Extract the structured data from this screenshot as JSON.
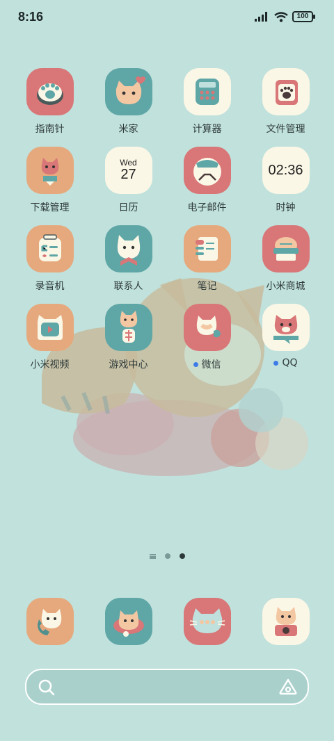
{
  "status_bar": {
    "time": "8:16",
    "battery": "100"
  },
  "apps": [
    {
      "label": "指南针",
      "icon": "paw-compass-icon",
      "badge": false
    },
    {
      "label": "米家",
      "icon": "cat-heart-icon",
      "badge": false
    },
    {
      "label": "计算器",
      "icon": "calculator-icon",
      "badge": false
    },
    {
      "label": "文件管理",
      "icon": "folder-paw-icon",
      "badge": false
    },
    {
      "label": "下载管理",
      "icon": "download-cat-icon",
      "badge": false
    },
    {
      "label": "日历",
      "icon": "calendar-icon",
      "badge": false,
      "day": "Wed",
      "date": "27"
    },
    {
      "label": "电子邮件",
      "icon": "mail-icon",
      "badge": false
    },
    {
      "label": "时钟",
      "icon": "clock-icon",
      "badge": false,
      "clock": "02:36"
    },
    {
      "label": "录音机",
      "icon": "recorder-icon",
      "badge": false
    },
    {
      "label": "联系人",
      "icon": "contacts-cat-icon",
      "badge": false
    },
    {
      "label": "笔记",
      "icon": "notes-icon",
      "badge": false
    },
    {
      "label": "小米商城",
      "icon": "store-icon",
      "badge": false
    },
    {
      "label": "小米视频",
      "icon": "video-icon",
      "badge": false
    },
    {
      "label": "游戏中心",
      "icon": "game-cat-icon",
      "badge": false
    },
    {
      "label": "微信",
      "icon": "wechat-cat-icon",
      "badge": true
    },
    {
      "label": "QQ",
      "icon": "qq-cat-icon",
      "badge": true
    }
  ],
  "dock": [
    {
      "icon": "phone-cat-icon"
    },
    {
      "icon": "messages-cat-icon"
    },
    {
      "icon": "browser-cat-icon"
    },
    {
      "icon": "camera-cat-icon"
    }
  ],
  "pager": {
    "pages": 2,
    "active": 2
  },
  "colors": {
    "background": "#c0e1dc",
    "pink": "#d97677",
    "teal": "#5fa6a6",
    "cream": "#fbf7e6",
    "orange": "#e6a97d",
    "badge": "#3d7be8"
  }
}
